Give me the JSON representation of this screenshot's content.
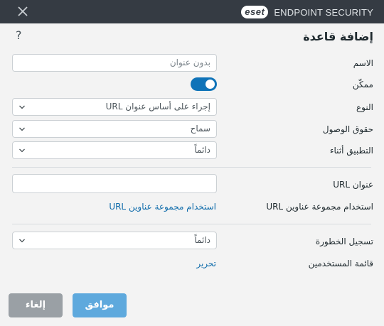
{
  "window": {
    "brand_logo": "eset",
    "product_name": "ENDPOINT SECURITY"
  },
  "dialog": {
    "title": "إضافة قاعدة",
    "help_glyph": "?"
  },
  "form": {
    "name": {
      "label": "الاسم",
      "placeholder": "بدون عنوان",
      "value": ""
    },
    "enabled": {
      "label": "ممكّن",
      "on": true
    },
    "type": {
      "label": "النوع",
      "value": "إجراء على أساس عنوان URL"
    },
    "access_rights": {
      "label": "حقوق الوصول",
      "value": "سماح"
    },
    "apply_during": {
      "label": "التطبيق أثناء",
      "value": "دائماً"
    },
    "url_address": {
      "label": "عنوان URL",
      "value": ""
    },
    "url_group": {
      "label": "استخدام مجموعة عناوين URL",
      "link": "استخدام مجموعة عناوين URL"
    },
    "log_severity": {
      "label": "تسجيل الخطورة",
      "value": "دائماً"
    },
    "user_list": {
      "label": "قائمة المستخدمين",
      "link": "تحرير"
    }
  },
  "buttons": {
    "ok": "موافق",
    "cancel": "إلغاء"
  },
  "colors": {
    "titlebar": "#353b43",
    "accent": "#0f73b8",
    "ok_button": "#5ea9dd",
    "cancel_button": "#9aa0a5",
    "link": "#0f6cab"
  }
}
